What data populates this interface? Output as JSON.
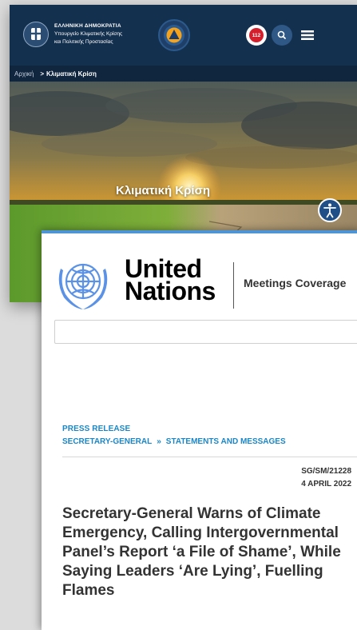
{
  "gov": {
    "title_main": "ΕΛΛΗΝΙΚΗ ΔΗΜΟΚΡΑΤΙΑ",
    "title_sub_1": "Υπουργείο Κλιματικής Κρίσης",
    "title_sub_2": "και Πολιτικής Προστασίας",
    "emergency_label": "112",
    "breadcrumb": {
      "home": "Αρχική",
      "separator": ">",
      "current": "Κλιματική Κρίση"
    },
    "hero_title": "Κλιματική Κρίση",
    "colors": {
      "header": "#14304f",
      "breadcrumb_bg": "#10263f",
      "emergency_red": "#d4202c"
    }
  },
  "un": {
    "wordmark_line1": "United",
    "wordmark_line2": "Nations",
    "section_link": "Meetings Coverage",
    "search": {
      "value": "",
      "placeholder": ""
    },
    "press_label": "PRESS RELEASE",
    "crumbs": {
      "first": "SECRETARY-GENERAL",
      "separator": "»",
      "second": "STATEMENTS AND MESSAGES"
    },
    "doc_number": "SG/SM/21228",
    "date": "4 APRIL 2022",
    "headline": "Secretary-General Warns of Climate Emergency, Calling Intergovernmental Panel’s Report ‘a File of Shame’, While Saying Leaders ‘Are Lying’, Fuelling Flames",
    "colors": {
      "accent_blue": "#1a86c9",
      "top_line": "#4f95d6",
      "emblem_blue": "#5b92e5"
    }
  }
}
